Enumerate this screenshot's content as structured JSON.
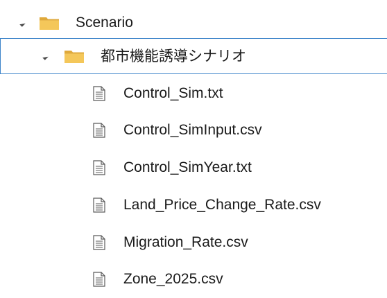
{
  "tree": {
    "root": {
      "label": "Scenario",
      "icon": "folder-icon",
      "expanded": true
    },
    "child_folder": {
      "label": "都市機能誘導シナリオ",
      "icon": "folder-icon",
      "expanded": true,
      "selected": true
    },
    "files": [
      {
        "label": "Control_Sim.txt",
        "icon": "document-icon"
      },
      {
        "label": "Control_SimInput.csv",
        "icon": "document-icon"
      },
      {
        "label": "Control_SimYear.txt",
        "icon": "document-icon"
      },
      {
        "label": "Land_Price_Change_Rate.csv",
        "icon": "document-icon"
      },
      {
        "label": "Migration_Rate.csv",
        "icon": "document-icon"
      },
      {
        "label": "Zone_2025.csv",
        "icon": "document-icon"
      }
    ]
  },
  "colors": {
    "folder": "#f4c75a",
    "folder_dark": "#e0a93a",
    "selection_border": "#3b83c9",
    "document_outline": "#5a5a5a"
  }
}
